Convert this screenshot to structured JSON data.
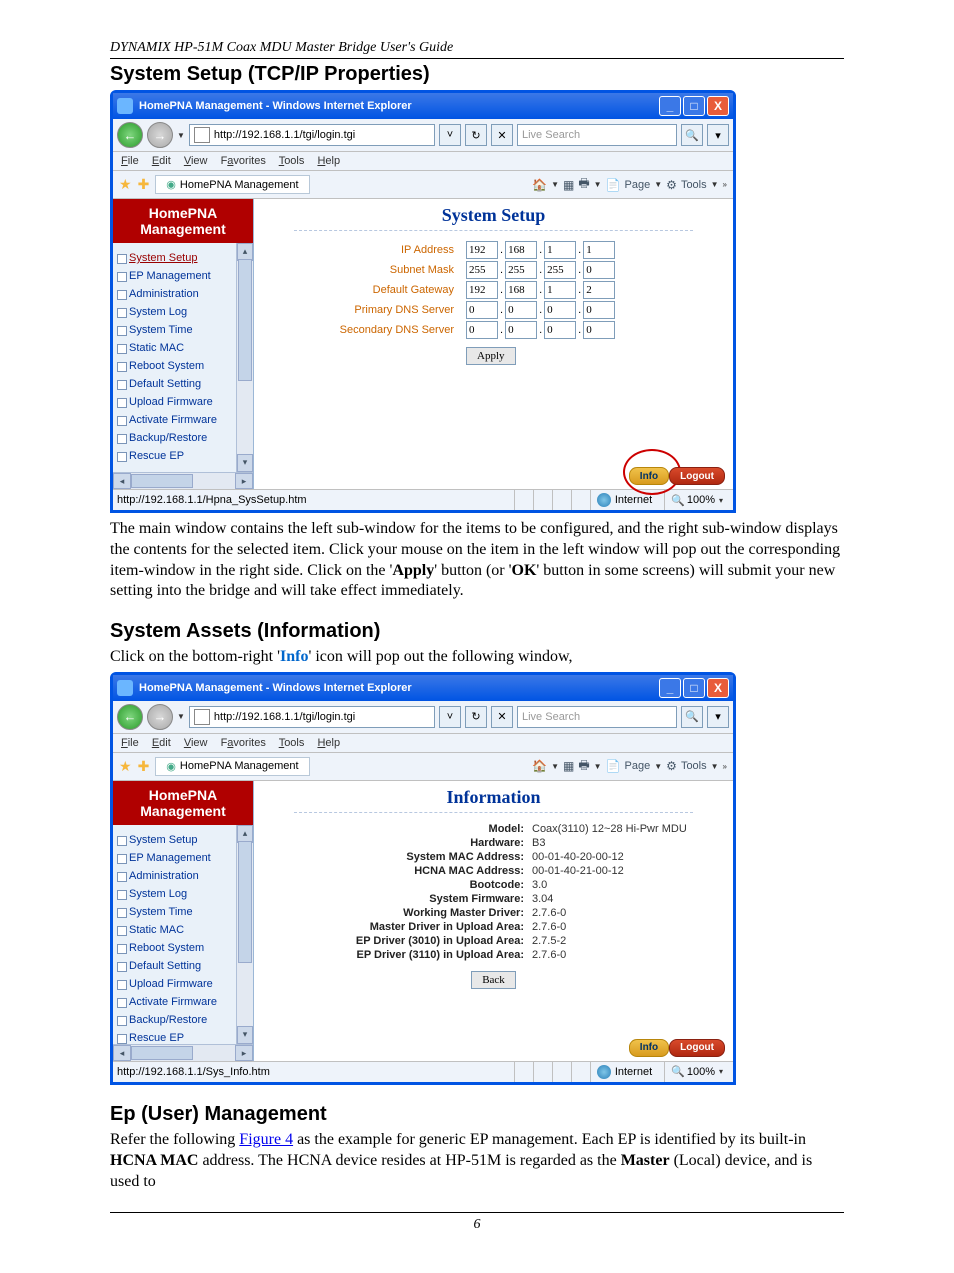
{
  "header_guide": "DYNAMIX HP-51M Coax MDU Master Bridge User's Guide",
  "page_number": "6",
  "sec1_title": "System Setup (TCP/IP Properties)",
  "sec1_body_a": "The main window contains the left sub-window for the items to be configured, and the right sub-window displays the contents for the selected item. Click your mouse on the item in the left window will pop out the corresponding item-window in the right side. Click on the '",
  "sec1_body_b": "' button (or '",
  "sec1_body_c": "' button in some screens) will submit your new setting into the bridge and will take effect immediately.",
  "apply_word": "Apply",
  "ok_word": "OK",
  "sec2_title": "System Assets (Information)",
  "sec2_intro_a": "Click on the bottom-right '",
  "sec2_intro_b": "' icon will pop out the following window,",
  "info_word": "Info",
  "sec3_title": "Ep (User) Management",
  "sec3_a": "Refer the following ",
  "sec3_link": "Figure 4",
  "sec3_b": " as the example for generic EP management. Each EP is identified by its built-in ",
  "sec3_c": " address. The HCNA device resides at HP-51M is regarded as the ",
  "sec3_d": " (Local) device, and is used to",
  "hcna_mac": "HCNA MAC",
  "master_word": "Master",
  "ie": {
    "title": "HomePNA Management - Windows Internet Explorer",
    "url": "http://192.168.1.1/tgi/login.tgi",
    "search_placeholder": "Live Search",
    "menus": {
      "file": "File",
      "edit": "Edit",
      "view": "View",
      "fav": "Favorites",
      "tools": "Tools",
      "help": "Help"
    },
    "tab": "HomePNA Management",
    "tool_page": "Page",
    "tool_tools": "Tools",
    "zone": "Internet",
    "zoom": "100%"
  },
  "brand1": "HomePNA",
  "brand2": "Management",
  "nav": {
    "items": [
      "System Setup",
      "EP Management",
      "Administration",
      "System Log",
      "System Time",
      "Static MAC",
      "Reboot System",
      "Default Setting",
      "Upload Firmware",
      "Activate Firmware",
      "Backup/Restore",
      "Rescue EP"
    ]
  },
  "syssetup": {
    "title": "System Setup",
    "labels": {
      "ip": "IP Address",
      "mask": "Subnet Mask",
      "gw": "Default Gateway",
      "dns1": "Primary DNS Server",
      "dns2": "Secondary DNS Server"
    },
    "ip": [
      "192",
      "168",
      "1",
      "1"
    ],
    "mask": [
      "255",
      "255",
      "255",
      "0"
    ],
    "gw": [
      "192",
      "168",
      "1",
      "2"
    ],
    "dns1": [
      "0",
      "0",
      "0",
      "0"
    ],
    "dns2": [
      "0",
      "0",
      "0",
      "0"
    ],
    "apply": "Apply",
    "status_url": "http://192.168.1.1/Hpna_SysSetup.htm"
  },
  "footer_btn": {
    "info": "Info",
    "logout": "Logout"
  },
  "information": {
    "title": "Information",
    "rows": [
      {
        "k": "Model:",
        "v": "Coax(3110) 12~28 Hi-Pwr MDU"
      },
      {
        "k": "Hardware:",
        "v": "B3"
      },
      {
        "k": "System MAC Address:",
        "v": "00-01-40-20-00-12"
      },
      {
        "k": "HCNA MAC Address:",
        "v": "00-01-40-21-00-12"
      },
      {
        "k": "Bootcode:",
        "v": "3.0"
      },
      {
        "k": "System Firmware:",
        "v": "3.04"
      },
      {
        "k": "Working Master Driver:",
        "v": "2.7.6-0"
      },
      {
        "k": "Master Driver in Upload Area:",
        "v": "2.7.6-0"
      },
      {
        "k": "EP Driver (3010) in Upload Area:",
        "v": "2.7.5-2"
      },
      {
        "k": "EP Driver (3110) in Upload Area:",
        "v": "2.7.6-0"
      }
    ],
    "back": "Back",
    "status_url": "http://192.168.1.1/Sys_Info.htm"
  }
}
